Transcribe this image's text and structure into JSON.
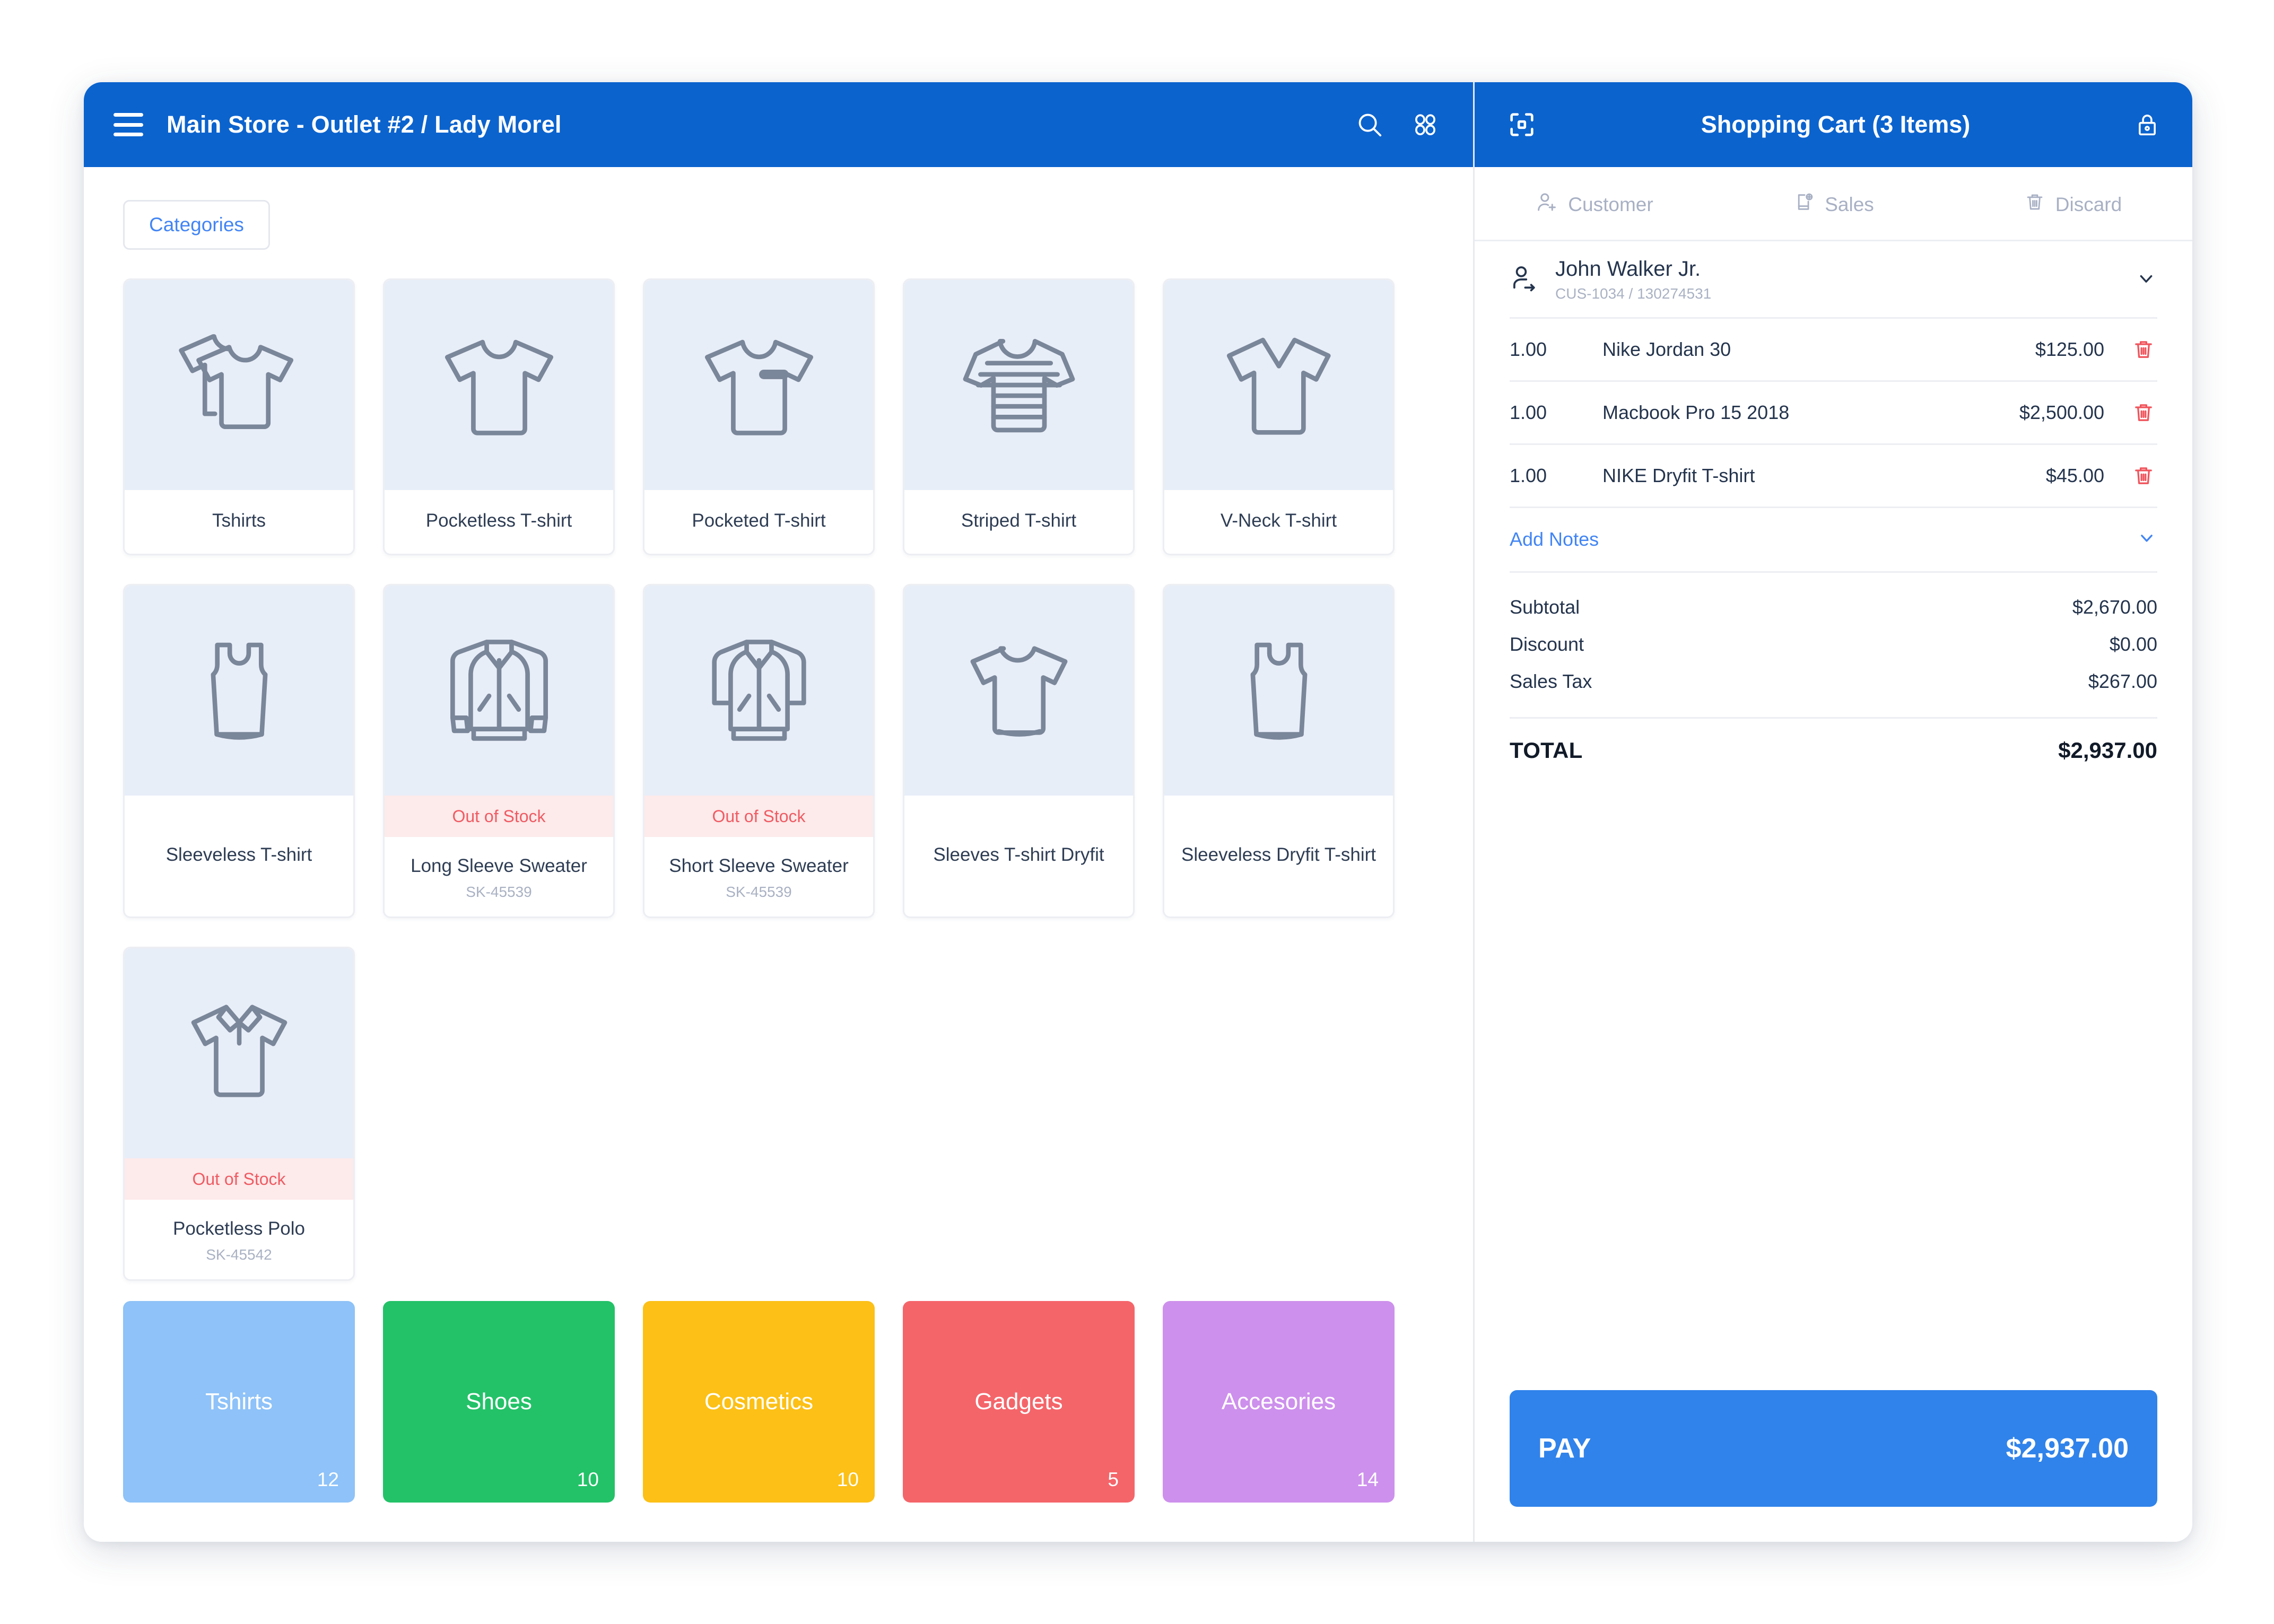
{
  "header": {
    "store_title": "Main Store - Outlet #2 / Lady Morel",
    "menu_icon": "hamburger-icon",
    "search_icon": "search-icon",
    "apps_icon": "apps-grid-icon"
  },
  "cart_header": {
    "scan_icon": "scan-icon",
    "title": "Shopping Cart (3 Items)",
    "lock_icon": "lock-icon"
  },
  "cart_tabs": [
    {
      "label": "Customer",
      "icon": "add-person-icon"
    },
    {
      "label": "Sales",
      "icon": "new-sale-icon"
    },
    {
      "label": "Discard",
      "icon": "trash-icon"
    }
  ],
  "customer": {
    "icon": "customer-switch-icon",
    "name": "John Walker Jr.",
    "reference": "CUS-1034 / 130274531",
    "chevron_icon": "chevron-down-icon"
  },
  "cart_items": [
    {
      "qty": "1.00",
      "name": "Nike Jordan 30",
      "price": "$125.00",
      "delete_icon": "trash-icon"
    },
    {
      "qty": "1.00",
      "name": "Macbook Pro 15 2018",
      "price": "$2,500.00",
      "delete_icon": "trash-icon"
    },
    {
      "qty": "1.00",
      "name": "NIKE Dryfit T-shirt",
      "price": "$45.00",
      "delete_icon": "trash-icon"
    }
  ],
  "notes": {
    "label": "Add Notes",
    "chevron_icon": "chevron-down-icon"
  },
  "totals": [
    {
      "label": "Subtotal",
      "value": "$2,670.00"
    },
    {
      "label": "Discount",
      "value": "$0.00"
    },
    {
      "label": "Sales Tax",
      "value": "$267.00"
    }
  ],
  "grand_total": {
    "label": "TOTAL",
    "value": "$2,937.00"
  },
  "pay": {
    "label": "PAY",
    "amount": "$2,937.00"
  },
  "toolbar": {
    "categories_label": "Categories"
  },
  "out_of_stock_label": "Out of Stock",
  "products": [
    {
      "name": "Tshirts",
      "sku": null,
      "icon": "double-tshirt-icon",
      "out_of_stock": false
    },
    {
      "name": "Pocketless T-shirt",
      "sku": null,
      "icon": "tshirt-icon",
      "out_of_stock": false
    },
    {
      "name": "Pocketed T-shirt",
      "sku": null,
      "icon": "pocket-tshirt-icon",
      "out_of_stock": false
    },
    {
      "name": "Striped T-shirt",
      "sku": null,
      "icon": "striped-tshirt-icon",
      "out_of_stock": false
    },
    {
      "name": "V-Neck T-shirt",
      "sku": null,
      "icon": "vneck-tshirt-icon",
      "out_of_stock": false
    },
    {
      "name": "Sleeveless T-shirt",
      "sku": null,
      "icon": "tank-top-icon",
      "out_of_stock": false
    },
    {
      "name": "Long Sleeve Sweater",
      "sku": "SK-45539",
      "icon": "long-sleeve-jacket-icon",
      "out_of_stock": true
    },
    {
      "name": "Short Sleeve Sweater",
      "sku": "SK-45539",
      "icon": "short-sleeve-jacket-icon",
      "out_of_stock": true
    },
    {
      "name": "Sleeves T-shirt Dryfit",
      "sku": null,
      "icon": "dryfit-tshirt-icon",
      "out_of_stock": false
    },
    {
      "name": "Sleeveless Dryfit T-shirt",
      "sku": null,
      "icon": "tank-top-icon",
      "out_of_stock": false
    },
    {
      "name": "Pocketless Polo",
      "sku": "SK-45542",
      "icon": "polo-shirt-icon",
      "out_of_stock": true
    }
  ],
  "categories": [
    {
      "label": "Tshirts",
      "count": "12",
      "color": "#8ec2f8"
    },
    {
      "label": "Shoes",
      "count": "10",
      "color": "#23c268"
    },
    {
      "label": "Cosmetics",
      "count": "10",
      "color": "#fcc016"
    },
    {
      "label": "Gadgets",
      "count": "5",
      "color": "#f4656a"
    },
    {
      "label": "Accesories",
      "count": "14",
      "color": "#cd90ec"
    }
  ],
  "colors": {
    "header_blue": "#0b63ce",
    "pay_blue": "#3083ea",
    "link_blue": "#4285f4",
    "out_of_stock_red": "#ef5b63",
    "delete_red": "#f0545c"
  }
}
